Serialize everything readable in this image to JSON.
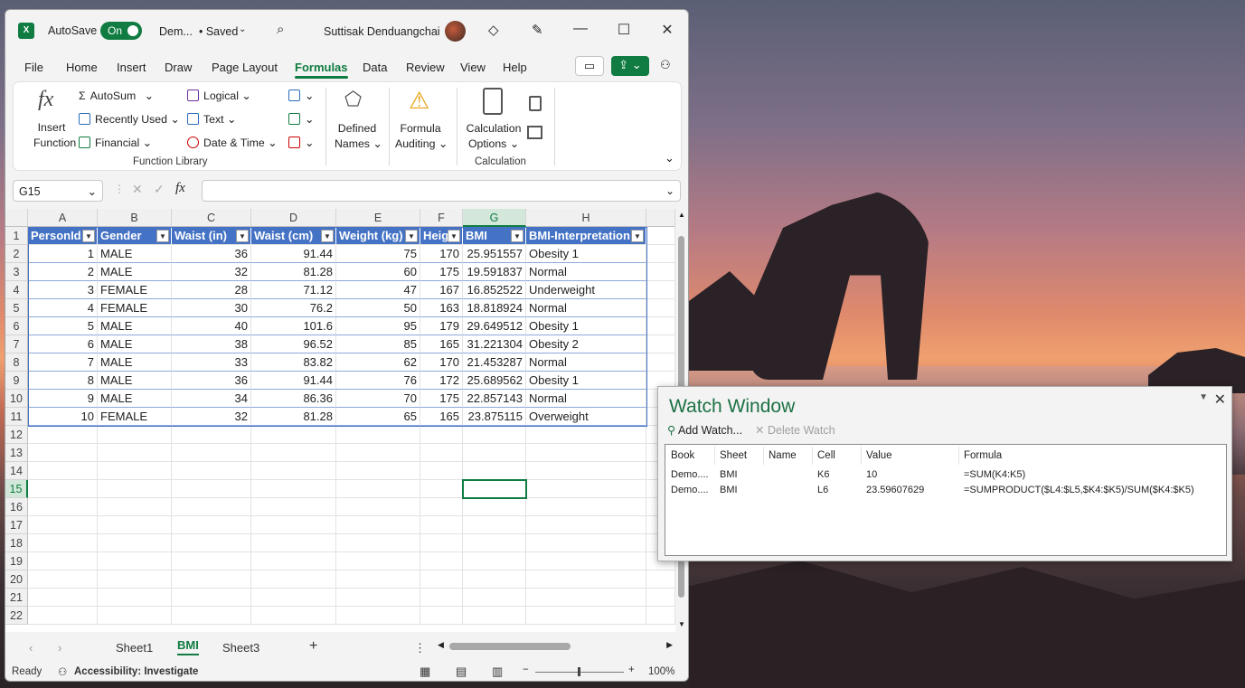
{
  "titlebar": {
    "autosave_label": "AutoSave",
    "autosave_state": "On",
    "doc_name": "Dem...",
    "saved_status": "• Saved",
    "user_name": "Suttisak Denduangchai"
  },
  "menu": [
    "File",
    "Home",
    "Insert",
    "Draw",
    "Page Layout",
    "Formulas",
    "Data",
    "Review",
    "View",
    "Help"
  ],
  "ribbon": {
    "insert_function": [
      "Insert",
      "Function"
    ],
    "autosum": "AutoSum",
    "recently_used": "Recently Used",
    "financial": "Financial",
    "logical": "Logical",
    "text": "Text",
    "date_time": "Date & Time",
    "defined_names": [
      "Defined",
      "Names"
    ],
    "formula_auditing": [
      "Formula",
      "Auditing"
    ],
    "calc_options": [
      "Calculation",
      "Options"
    ],
    "group_function_library": "Function Library",
    "group_calculation": "Calculation"
  },
  "formula_bar": {
    "name_box": "G15",
    "formula": ""
  },
  "grid": {
    "columns": [
      "A",
      "B",
      "C",
      "D",
      "E",
      "F",
      "G",
      "H"
    ],
    "selected_column": "G",
    "selected_row": "15",
    "rows": [
      "1",
      "2",
      "3",
      "4",
      "5",
      "6",
      "7",
      "8",
      "9",
      "10",
      "11",
      "12",
      "13",
      "14",
      "15",
      "16",
      "17",
      "18",
      "19",
      "20",
      "21",
      "22"
    ],
    "headers": [
      "PersonId",
      "Gender",
      "Waist (in)",
      "Waist (cm)",
      "Weight (kg)",
      "Heig",
      "BMI",
      "BMI-Interpretation"
    ],
    "data": [
      [
        "1",
        "MALE",
        "36",
        "91.44",
        "75",
        "170",
        "25.951557",
        "Obesity 1"
      ],
      [
        "2",
        "MALE",
        "32",
        "81.28",
        "60",
        "175",
        "19.591837",
        "Normal"
      ],
      [
        "3",
        "FEMALE",
        "28",
        "71.12",
        "47",
        "167",
        "16.852522",
        "Underweight"
      ],
      [
        "4",
        "FEMALE",
        "30",
        "76.2",
        "50",
        "163",
        "18.818924",
        "Normal"
      ],
      [
        "5",
        "MALE",
        "40",
        "101.6",
        "95",
        "179",
        "29.649512",
        "Obesity 1"
      ],
      [
        "6",
        "MALE",
        "38",
        "96.52",
        "85",
        "165",
        "31.221304",
        "Obesity 2"
      ],
      [
        "7",
        "MALE",
        "33",
        "83.82",
        "62",
        "170",
        "21.453287",
        "Normal"
      ],
      [
        "8",
        "MALE",
        "36",
        "91.44",
        "76",
        "172",
        "25.689562",
        "Obesity 1"
      ],
      [
        "9",
        "MALE",
        "34",
        "86.36",
        "70",
        "175",
        "22.857143",
        "Normal"
      ],
      [
        "10",
        "FEMALE",
        "32",
        "81.28",
        "65",
        "165",
        "23.875115",
        "Overweight"
      ]
    ]
  },
  "sheets": {
    "tabs": [
      "Sheet1",
      "BMI",
      "Sheet3"
    ],
    "active": "BMI"
  },
  "status": {
    "ready": "Ready",
    "accessibility": "Accessibility: Investigate",
    "zoom": "100%"
  },
  "watch_window": {
    "title": "Watch Window",
    "add_watch": "Add Watch...",
    "delete_watch": "Delete Watch",
    "columns": [
      "Book",
      "Sheet",
      "Name",
      "Cell",
      "Value",
      "Formula"
    ],
    "rows": [
      {
        "book": "Demo....",
        "sheet": "BMI",
        "name": "",
        "cell": "K6",
        "value": "10",
        "formula": "=SUM(K4:K5)"
      },
      {
        "book": "Demo....",
        "sheet": "BMI",
        "name": "",
        "cell": "L6",
        "value": "23.59607629",
        "formula": "=SUMPRODUCT($L4:$L5,$K4:$K5)/SUM($K4:$K5)"
      }
    ]
  },
  "colors": {
    "accent": "#107c41",
    "table_header": "#4472c4"
  }
}
